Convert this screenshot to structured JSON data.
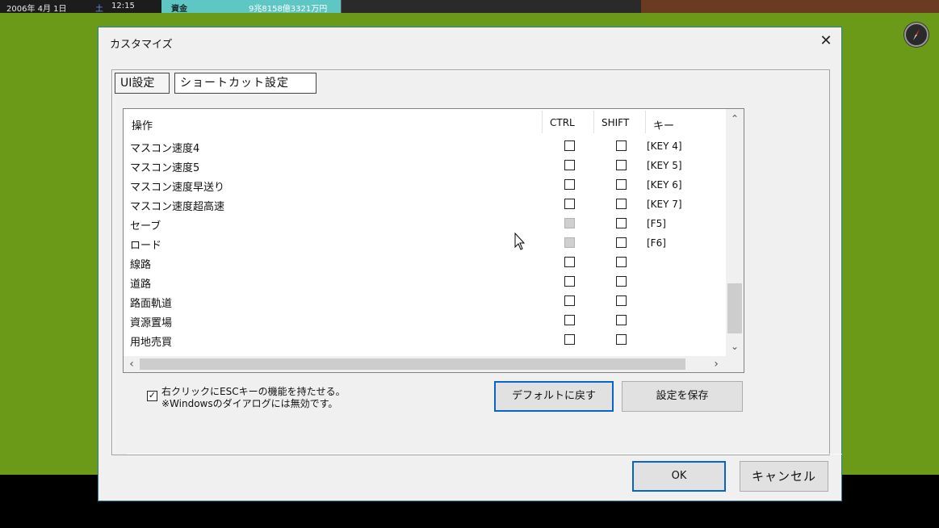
{
  "topbar": {
    "date": "2006年 4月 1日",
    "day_of_week": "土",
    "time": "12:15",
    "funds_label": "資金",
    "funds_value": "9兆8158億3321万円"
  },
  "dialog": {
    "title": "カスタマイズ",
    "close_label": "✕",
    "tabs": [
      {
        "label": "UI設定"
      },
      {
        "label": "ショートカット設定"
      }
    ],
    "columns": {
      "operation": "操作",
      "ctrl": "CTRL",
      "shift": "SHIFT",
      "key": "キー"
    },
    "rows": [
      {
        "op": "マスコン速度4",
        "key": "[KEY 4]"
      },
      {
        "op": "マスコン速度5",
        "key": "[KEY 5]"
      },
      {
        "op": "マスコン速度早送り",
        "key": "[KEY 6]"
      },
      {
        "op": "マスコン速度超高速",
        "key": "[KEY 7]"
      },
      {
        "op": "セーブ",
        "key": "[F5]"
      },
      {
        "op": "ロード",
        "key": "[F6]"
      },
      {
        "op": "線路",
        "key": ""
      },
      {
        "op": "道路",
        "key": ""
      },
      {
        "op": "路面軌道",
        "key": ""
      },
      {
        "op": "資源置場",
        "key": ""
      },
      {
        "op": "用地売買",
        "key": ""
      }
    ],
    "right_click_option_line1": "右クリックにESCキーの機能を持たせる。",
    "right_click_option_line2": "※Windowsのダイアログには無効です。",
    "check_mark": "✓",
    "buttons": {
      "default": "デフォルトに戻す",
      "save": "設定を保存",
      "ok": "OK",
      "cancel": "キャンセル"
    },
    "scroll_arrows": {
      "up": "⌃",
      "down": "⌄",
      "left": "‹",
      "right": "›"
    }
  }
}
